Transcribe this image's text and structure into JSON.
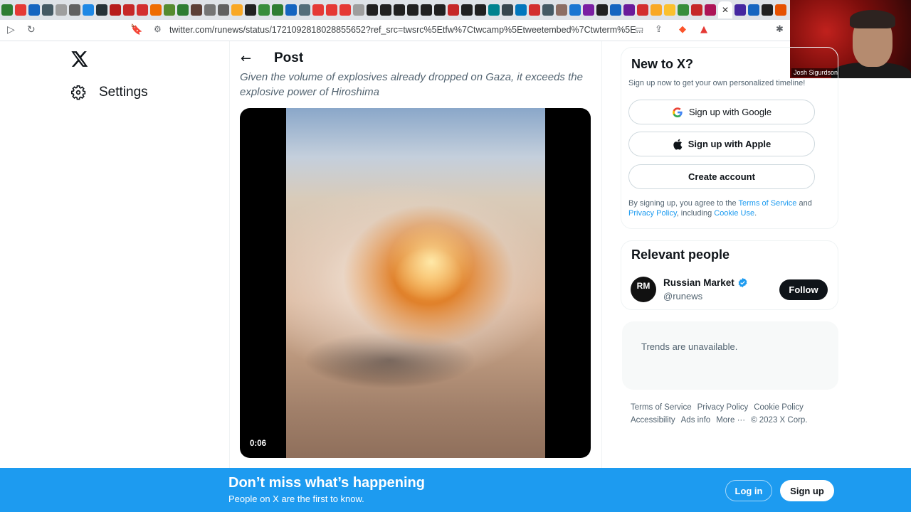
{
  "browser": {
    "tab_icons": [
      {
        "icon": "tab-favicon",
        "color": "#2e7d32"
      },
      {
        "icon": "tab-favicon",
        "color": "#e53935"
      },
      {
        "icon": "tab-favicon",
        "color": "#1565c0"
      },
      {
        "icon": "tab-favicon",
        "color": "#455a64"
      },
      {
        "icon": "tab-favicon",
        "color": "#9e9e9e"
      },
      {
        "icon": "tab-favicon",
        "color": "#616161"
      },
      {
        "icon": "tab-favicon",
        "color": "#1e88e5"
      },
      {
        "icon": "tab-favicon",
        "color": "#263238"
      },
      {
        "icon": "tab-favicon",
        "color": "#b71c1c"
      },
      {
        "icon": "tab-favicon",
        "color": "#c62828"
      },
      {
        "icon": "tab-favicon",
        "color": "#d32f2f"
      },
      {
        "icon": "tab-favicon",
        "color": "#ef6c00"
      },
      {
        "icon": "tab-favicon",
        "color": "#558b2f"
      },
      {
        "icon": "tab-favicon",
        "color": "#2e7d32"
      },
      {
        "icon": "tab-favicon",
        "color": "#5d4037"
      },
      {
        "icon": "tab-favicon",
        "color": "#757575"
      },
      {
        "icon": "tab-favicon",
        "color": "#616161"
      },
      {
        "icon": "tab-favicon",
        "color": "#f9a825"
      },
      {
        "icon": "tab-favicon",
        "color": "#212121"
      },
      {
        "icon": "tab-favicon",
        "color": "#388e3c"
      },
      {
        "icon": "tab-favicon",
        "color": "#2e7d32"
      },
      {
        "icon": "tab-favicon",
        "color": "#1565c0"
      },
      {
        "icon": "tab-favicon",
        "color": "#546e7a"
      },
      {
        "icon": "tab-favicon",
        "color": "#e53935"
      },
      {
        "icon": "tab-favicon",
        "color": "#e53935"
      },
      {
        "icon": "tab-favicon",
        "color": "#e53935"
      },
      {
        "icon": "tab-favicon",
        "color": "#9e9e9e"
      },
      {
        "icon": "tab-favicon",
        "color": "#212121"
      },
      {
        "icon": "tab-favicon",
        "color": "#212121"
      },
      {
        "icon": "tab-favicon",
        "color": "#212121"
      },
      {
        "icon": "tab-favicon",
        "color": "#212121"
      },
      {
        "icon": "tab-favicon",
        "color": "#212121"
      },
      {
        "icon": "tab-favicon",
        "color": "#212121"
      },
      {
        "icon": "tab-favicon",
        "color": "#c62828"
      },
      {
        "icon": "tab-favicon",
        "color": "#212121"
      },
      {
        "icon": "tab-favicon",
        "color": "#212121"
      },
      {
        "icon": "tab-favicon",
        "color": "#00838f"
      },
      {
        "icon": "tab-favicon",
        "color": "#37474f"
      },
      {
        "icon": "tab-favicon",
        "color": "#0277bd"
      },
      {
        "icon": "tab-favicon",
        "color": "#d32f2f"
      },
      {
        "icon": "tab-favicon",
        "color": "#455a64"
      },
      {
        "icon": "tab-favicon",
        "color": "#8d6e63"
      },
      {
        "icon": "tab-favicon",
        "color": "#1976d2"
      },
      {
        "icon": "tab-favicon",
        "color": "#7b1fa2"
      },
      {
        "icon": "tab-favicon",
        "color": "#212121"
      },
      {
        "icon": "tab-favicon",
        "color": "#1565c0"
      },
      {
        "icon": "tab-favicon",
        "color": "#6a1b9a"
      },
      {
        "icon": "tab-favicon",
        "color": "#d32f2f"
      },
      {
        "icon": "tab-favicon",
        "color": "#f9a825"
      },
      {
        "icon": "tab-favicon",
        "color": "#fbc02d"
      },
      {
        "icon": "tab-favicon",
        "color": "#388e3c"
      },
      {
        "icon": "tab-favicon",
        "color": "#c62828"
      },
      {
        "icon": "tab-favicon",
        "color": "#ad1457"
      }
    ],
    "tab_icons_after": [
      {
        "icon": "tab-favicon",
        "color": "#4527a0"
      },
      {
        "icon": "tab-favicon",
        "color": "#1565c0"
      },
      {
        "icon": "tab-favicon",
        "color": "#212121"
      },
      {
        "icon": "tab-favicon",
        "color": "#e65100"
      }
    ],
    "active_tab_close": "✕",
    "new_tab": "+",
    "url": "twitter.com/runews/status/1721092818028855652?ref_src=twsrc%5Etfw%7Ctwcamp%5Etweetembed%7Ctwterm%5E..."
  },
  "webcam": {
    "name": "Josh Sigurdson"
  },
  "nav": {
    "settings_label": "Settings"
  },
  "post": {
    "header": "Post",
    "caption": "Given the volume of explosives already dropped on Gaza, it exceeds the explosive power of Hiroshima",
    "video_time": "0:06"
  },
  "signup": {
    "title": "New to X?",
    "subtitle": "Sign up now to get your own personalized timeline!",
    "google_label": "Sign up with Google",
    "apple_label": "Sign up with Apple",
    "create_label": "Create account",
    "legal_pre": "By signing up, you agree to the ",
    "terms": "Terms of Service",
    "legal_and": " and ",
    "privacy": "Privacy Policy",
    "legal_including": ", including ",
    "cookie": "Cookie Use",
    "legal_end": "."
  },
  "people": {
    "title": "Relevant people",
    "avatar_text": "RM",
    "name": "Russian Market",
    "handle": "@runews",
    "follow_label": "Follow"
  },
  "trends": {
    "text": "Trends are unavailable."
  },
  "footer": {
    "links": [
      "Terms of Service",
      "Privacy Policy",
      "Cookie Policy",
      "Accessibility",
      "Ads info",
      "More ···",
      "© 2023 X Corp."
    ]
  },
  "banner": {
    "title": "Don’t miss what’s happening",
    "subtitle": "People on X are the first to know.",
    "login_label": "Log in",
    "signup_label": "Sign up"
  },
  "colors": {
    "accent": "#1d9bf0",
    "dark": "#0f1419",
    "muted": "#536471"
  }
}
